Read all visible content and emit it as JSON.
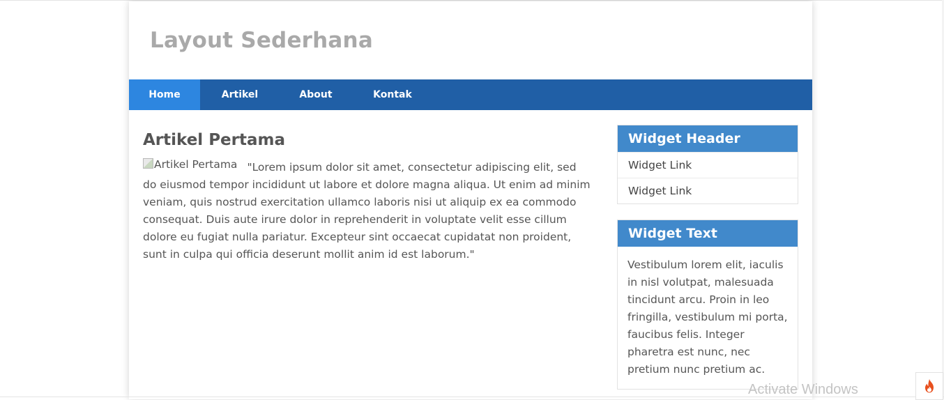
{
  "site": {
    "title": "Layout Sederhana"
  },
  "nav": {
    "items": [
      {
        "label": "Home",
        "active": true
      },
      {
        "label": "Artikel",
        "active": false
      },
      {
        "label": "About",
        "active": false
      },
      {
        "label": "Kontak",
        "active": false
      }
    ]
  },
  "article": {
    "title": "Artikel Pertama",
    "image_alt": "Artikel Pertama",
    "body": "\"Lorem ipsum dolor sit amet, consectetur adipiscing elit, sed do eiusmod tempor incididunt ut labore et dolore magna aliqua. Ut enim ad minim veniam, quis nostrud exercitation ullamco laboris nisi ut aliquip ex ea commodo consequat. Duis aute irure dolor in reprehenderit in voluptate velit esse cillum dolore eu fugiat nulla pariatur. Excepteur sint occaecat cupidatat non proident, sunt in culpa qui officia deserunt mollit anim id est laborum.\""
  },
  "sidebar": {
    "widget_links": {
      "header": "Widget Header",
      "links": [
        "Widget Link",
        "Widget Link"
      ]
    },
    "widget_text": {
      "header": "Widget Text",
      "text": "Vestibulum lorem elit, iaculis in nisl volutpat, malesuada tincidunt arcu. Proin in leo fringilla, vestibulum mi porta, faucibus felis. Integer pharetra est nunc, nec pretium nunc pretium ac."
    }
  },
  "overlay": {
    "watermark": "Activate Windows",
    "flame_icon": "flame-icon"
  },
  "colors": {
    "nav_bg": "#205fa6",
    "nav_active": "#2d86e0",
    "widget_header_bg": "#4189cb",
    "site_title": "#a9a9a9"
  }
}
